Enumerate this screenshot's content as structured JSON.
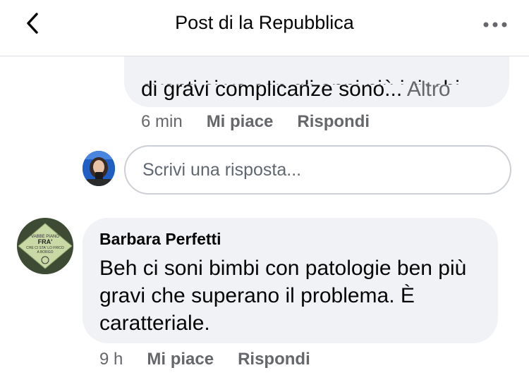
{
  "header": {
    "title": "Post di la Repubblica"
  },
  "comment_prev": {
    "clipped_line": "avanti si va con gli anni più i rischi",
    "text": "di gravi complicanze sono...",
    "more_label": "Altro",
    "time": "6 min",
    "like_label": "Mi piace",
    "reply_label": "Rispondi"
  },
  "reply_box": {
    "placeholder": "Scrivi una risposta..."
  },
  "comment_bp": {
    "author": "Barbara Perfetti",
    "avatar_text": [
      "VABBE PIANO",
      "FRA'",
      "CHE CI STA' LO FRICO",
      "A BORGO"
    ],
    "text": "Beh ci soni bimbi con patologie ben più gravi che superano il problema.  È caratteriale.",
    "time": "9 h",
    "like_label": "Mi piace",
    "reply_label": "Rispondi"
  },
  "colors": {
    "bubble": "#f0f2f5",
    "secondary_text": "#65676b",
    "divider": "#dadde1"
  }
}
